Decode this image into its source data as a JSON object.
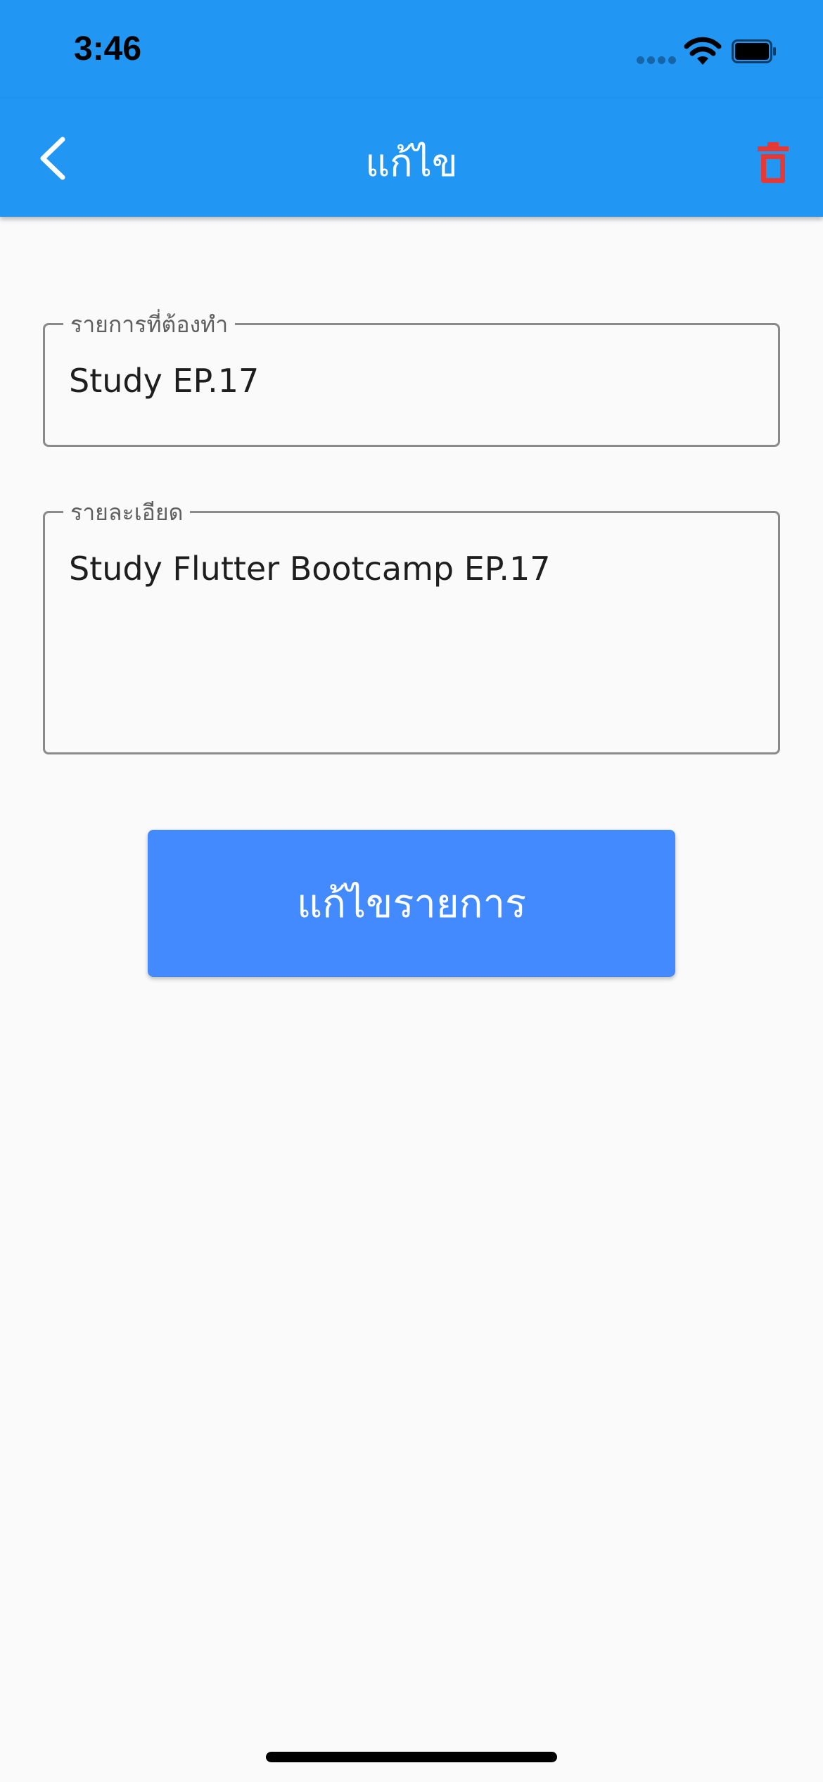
{
  "status_bar": {
    "time": "3:46",
    "icons": [
      "signal-dots-icon",
      "wifi-icon",
      "battery-icon"
    ]
  },
  "app_bar": {
    "title": "แก้ไข",
    "back_icon": "chevron-left-icon",
    "delete_icon": "trash-icon",
    "delete_color": "#e53935",
    "background": "#2196f3"
  },
  "form": {
    "todo": {
      "label": "รายการที่ต้องทำ",
      "value": "Study EP.17"
    },
    "detail": {
      "label": "รายละเอียด",
      "value": "Study Flutter Bootcamp EP.17"
    },
    "submit_label": "แก้ไขรายการ",
    "submit_color": "#448aff"
  }
}
